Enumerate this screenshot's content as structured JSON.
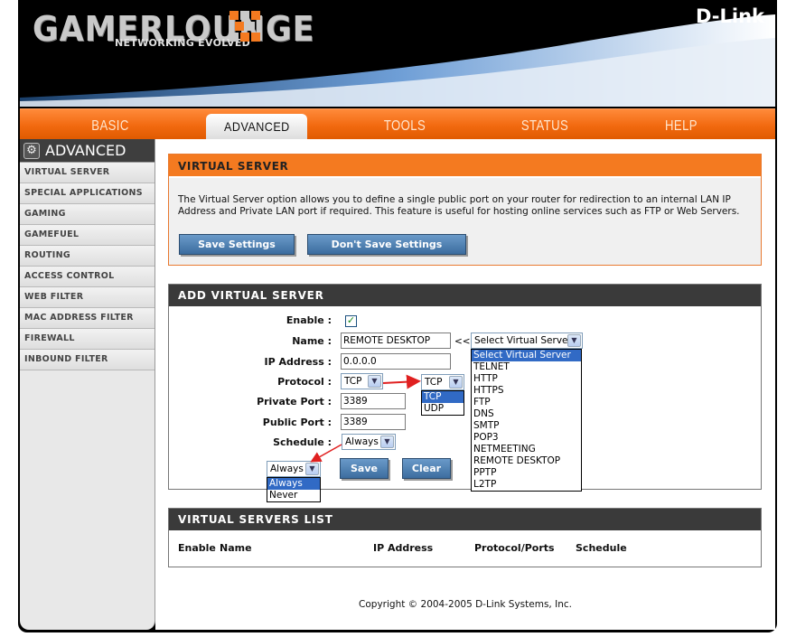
{
  "header": {
    "logo_text": "GAMERLOUNGE",
    "logo_tagline": "NETWORKING EVOLVED",
    "brand": "D-Link"
  },
  "tabs": [
    {
      "label": "BASIC"
    },
    {
      "label": "ADVANCED"
    },
    {
      "label": "TOOLS"
    },
    {
      "label": "STATUS"
    },
    {
      "label": "HELP"
    }
  ],
  "sidebar": {
    "title": "ADVANCED",
    "items": [
      {
        "label": "VIRTUAL SERVER"
      },
      {
        "label": "SPECIAL APPLICATIONS"
      },
      {
        "label": "GAMING"
      },
      {
        "label": "GAMEFUEL"
      },
      {
        "label": "ROUTING"
      },
      {
        "label": "ACCESS CONTROL"
      },
      {
        "label": "WEB FILTER"
      },
      {
        "label": "MAC ADDRESS FILTER"
      },
      {
        "label": "FIREWALL"
      },
      {
        "label": "INBOUND FILTER"
      }
    ]
  },
  "virtual_server": {
    "title": "VIRTUAL SERVER",
    "description": "The Virtual Server option allows you to define a single public port on your router for redirection to an internal LAN IP Address and Private LAN port if required. This feature is useful for hosting online services such as FTP or Web Servers.",
    "save_label": "Save Settings",
    "dont_save_label": "Don't Save Settings"
  },
  "add_form": {
    "title": "ADD VIRTUAL SERVER",
    "enable_label": "Enable :",
    "enable_checked": true,
    "name_label": "Name :",
    "name_value": "REMOTE DESKTOP",
    "copy_arrow": "<<",
    "ip_label": "IP Address :",
    "ip_value": "0.0.0.0",
    "protocol_label": "Protocol :",
    "protocol_value": "TCP",
    "private_port_label": "Private Port :",
    "private_port_value": "3389",
    "public_port_label": "Public Port :",
    "public_port_value": "3389",
    "schedule_label": "Schedule :",
    "schedule_value": "Always",
    "save_label": "Save",
    "clear_label": "Clear",
    "server_select": {
      "value": "Select Virtual Server",
      "options": [
        "Select Virtual Server",
        "TELNET",
        "HTTP",
        "HTTPS",
        "FTP",
        "DNS",
        "SMTP",
        "POP3",
        "NETMEETING",
        "REMOTE DESKTOP",
        "PPTP",
        "L2TP"
      ]
    },
    "protocol_popup": {
      "value": "TCP",
      "options": [
        "TCP",
        "UDP"
      ]
    },
    "schedule_popup": {
      "value": "Always",
      "options": [
        "Always",
        "Never"
      ]
    }
  },
  "list": {
    "title": "VIRTUAL SERVERS LIST",
    "columns": [
      "Enable",
      "Name",
      "IP Address",
      "Protocol/Ports",
      "Schedule"
    ]
  },
  "footer": {
    "copyright": "Copyright © 2004-2005 D-Link Systems, Inc."
  },
  "colors": {
    "orange": "#f47a20",
    "dark": "#3a3a3a",
    "button_blue": "#4a7cae",
    "highlight": "#316ac5",
    "arrow_red": "#e02020"
  }
}
